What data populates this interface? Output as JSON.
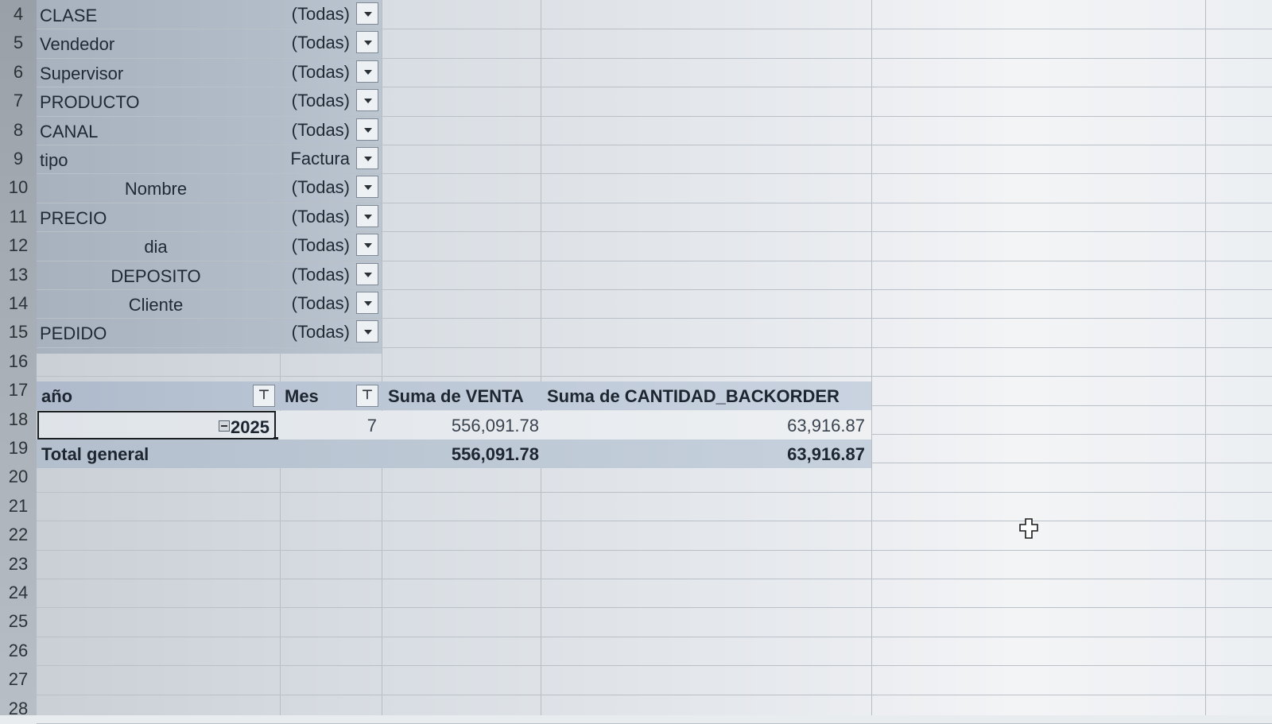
{
  "row_numbers": [
    "4",
    "5",
    "6",
    "7",
    "8",
    "9",
    "10",
    "11",
    "12",
    "13",
    "14",
    "15",
    "16",
    "17",
    "18",
    "19",
    "20",
    "21",
    "22",
    "23",
    "24",
    "25",
    "26",
    "27",
    "28"
  ],
  "filters": [
    {
      "label": "CLASE",
      "value": "(Todas)",
      "indent": false
    },
    {
      "label": "Vendedor",
      "value": "(Todas)",
      "indent": false
    },
    {
      "label": "Supervisor",
      "value": "(Todas)",
      "indent": false
    },
    {
      "label": "PRODUCTO",
      "value": "(Todas)",
      "indent": false
    },
    {
      "label": "CANAL",
      "value": "(Todas)",
      "indent": false
    },
    {
      "label": "tipo",
      "value": "Factura",
      "indent": false
    },
    {
      "label": "Nombre",
      "value": "(Todas)",
      "indent": true
    },
    {
      "label": "PRECIO",
      "value": "(Todas)",
      "indent": false
    },
    {
      "label": "dia",
      "value": "(Todas)",
      "indent": true
    },
    {
      "label": "DEPOSITO",
      "value": "(Todas)",
      "indent": true
    },
    {
      "label": "Cliente",
      "value": "(Todas)",
      "indent": true
    },
    {
      "label": "PEDIDO",
      "value": "(Todas)",
      "indent": false
    }
  ],
  "pivot": {
    "headers": {
      "year": "año",
      "month": "Mes",
      "sum_venta": "Suma de VENTA",
      "sum_backorder": "Suma de CANTIDAD_BACKORDER"
    },
    "row": {
      "year": "2025",
      "month": "7",
      "sum_venta": "556,091.78",
      "sum_backorder": "63,916.87"
    },
    "total": {
      "label": "Total general",
      "sum_venta": "556,091.78",
      "sum_backorder": "63,916.87"
    }
  },
  "icons": {
    "dropdown": "chevron-down-icon",
    "filter": "filter-icon",
    "collapse": "collapse-icon",
    "cursor": "cross-cursor-icon"
  }
}
